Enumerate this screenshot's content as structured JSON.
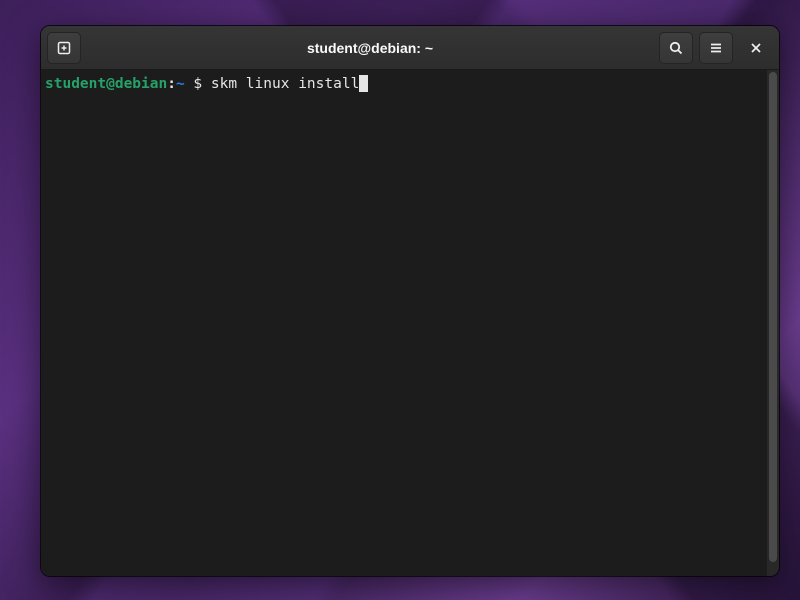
{
  "window": {
    "title": "student@debian: ~"
  },
  "terminal": {
    "prompt": {
      "user_host": "student@debian",
      "separator": ":",
      "path": "~",
      "symbol": "$"
    },
    "command": "skm linux install"
  },
  "icons": {
    "new_tab": "new-tab",
    "search": "search",
    "menu": "hamburger-menu",
    "close": "close"
  }
}
